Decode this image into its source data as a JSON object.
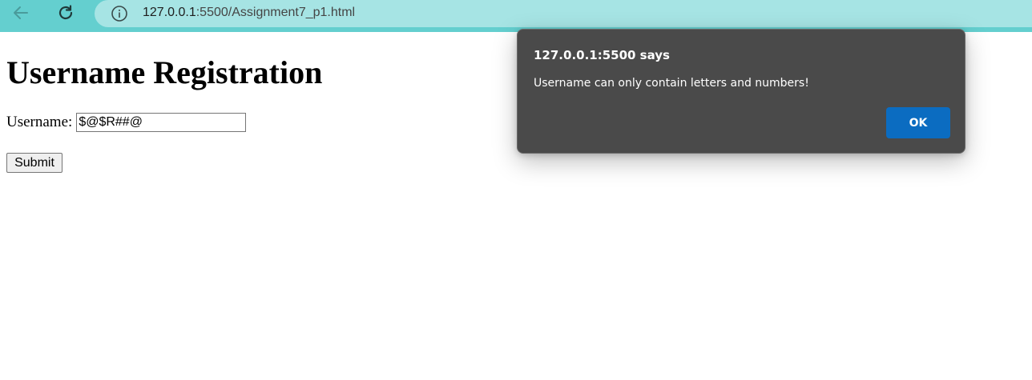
{
  "browser": {
    "url_host": "127.0.0.1",
    "url_rest": ":5500/Assignment7_p1.html",
    "colors": {
      "topbar": "#64cfcf",
      "addressbar": "#a6e4e4"
    }
  },
  "page": {
    "title": "Username Registration",
    "username_label": "Username:",
    "username_value": "$@$R##@",
    "submit_label": "Submit"
  },
  "dialog": {
    "title": "127.0.0.1:5500 says",
    "message": "Username can only contain letters and numbers!",
    "ok_label": "OK",
    "colors": {
      "background": "#4a4a4a",
      "ok_button": "#0b6cc1"
    }
  },
  "icons": [
    "back-arrow-icon",
    "reload-icon",
    "info-icon"
  ]
}
